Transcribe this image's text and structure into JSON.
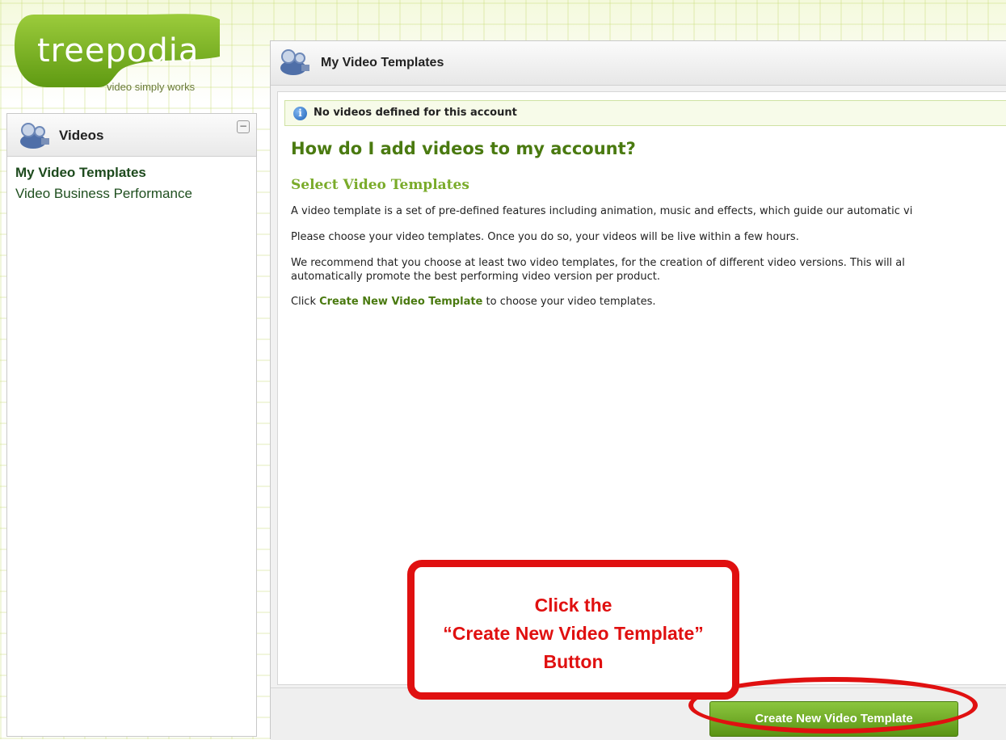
{
  "logo": {
    "wordmark": "treepodia",
    "tagline": "video simply works"
  },
  "sidebar": {
    "title": "Videos",
    "collapse_symbol": "−",
    "items": [
      {
        "label": "My Video Templates",
        "active": true
      },
      {
        "label": "Video Business Performance",
        "active": false
      }
    ]
  },
  "main": {
    "title": "My Video Templates",
    "notice": "No videos defined for this account",
    "heading": "How do I add videos to my account?",
    "subheading": "Select Video Templates",
    "paragraphs": {
      "p1": "A video template is a set of pre-defined features including animation, music and effects, which guide our automatic vi",
      "p2": "Please choose your video templates. Once you do so, your videos will be live within a few hours.",
      "p3_line1": "We recommend that you choose at least two video templates, for the creation of different video versions. This will al",
      "p3_line2": "automatically promote the best performing video version per product.",
      "p4_prefix": "Click ",
      "p4_link": "Create New Video Template",
      "p4_suffix": " to choose your video templates."
    },
    "create_button": "Create New Video Template"
  },
  "annotation": {
    "line1": "Click the",
    "line2": "“Create New Video Template”",
    "line3": "Button"
  },
  "icons": {
    "header_icon": "video-camera-icon",
    "info_icon": "info-icon"
  },
  "colors": {
    "brand_green": "#7aab2a",
    "dark_green": "#4a7a10",
    "annotation_red": "#e01010"
  }
}
